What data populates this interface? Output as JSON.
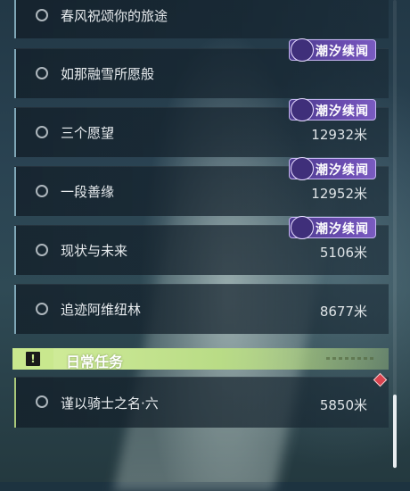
{
  "quests": [
    {
      "title": "春风祝颂你的旅途",
      "distance": "",
      "tag": ""
    },
    {
      "title": "如那融雪所愿般",
      "distance": "",
      "tag": "潮汐续闻"
    },
    {
      "title": "三个愿望",
      "distance": "12932米",
      "tag": "潮汐续闻"
    },
    {
      "title": "一段善缘",
      "distance": "12952米",
      "tag": "潮汐续闻"
    },
    {
      "title": "现状与未来",
      "distance": "5106米",
      "tag": "潮汐续闻"
    },
    {
      "title": "追迹阿维纽林",
      "distance": "8677米",
      "tag": ""
    }
  ],
  "daily_section": {
    "title": "日常任务",
    "alert_glyph": "!",
    "quest": {
      "title": "谨以骑士之名·六",
      "distance": "5850米"
    }
  },
  "colors": {
    "tag_bg": "#6d4fb4",
    "daily_accent": "#b9dc86",
    "marker_red": "#d9434f"
  },
  "icons": {
    "tag": "tide-swirl-icon",
    "status": "circle-outline-icon",
    "section": "alert-icon",
    "marker": "red-diamond-marker-icon"
  }
}
